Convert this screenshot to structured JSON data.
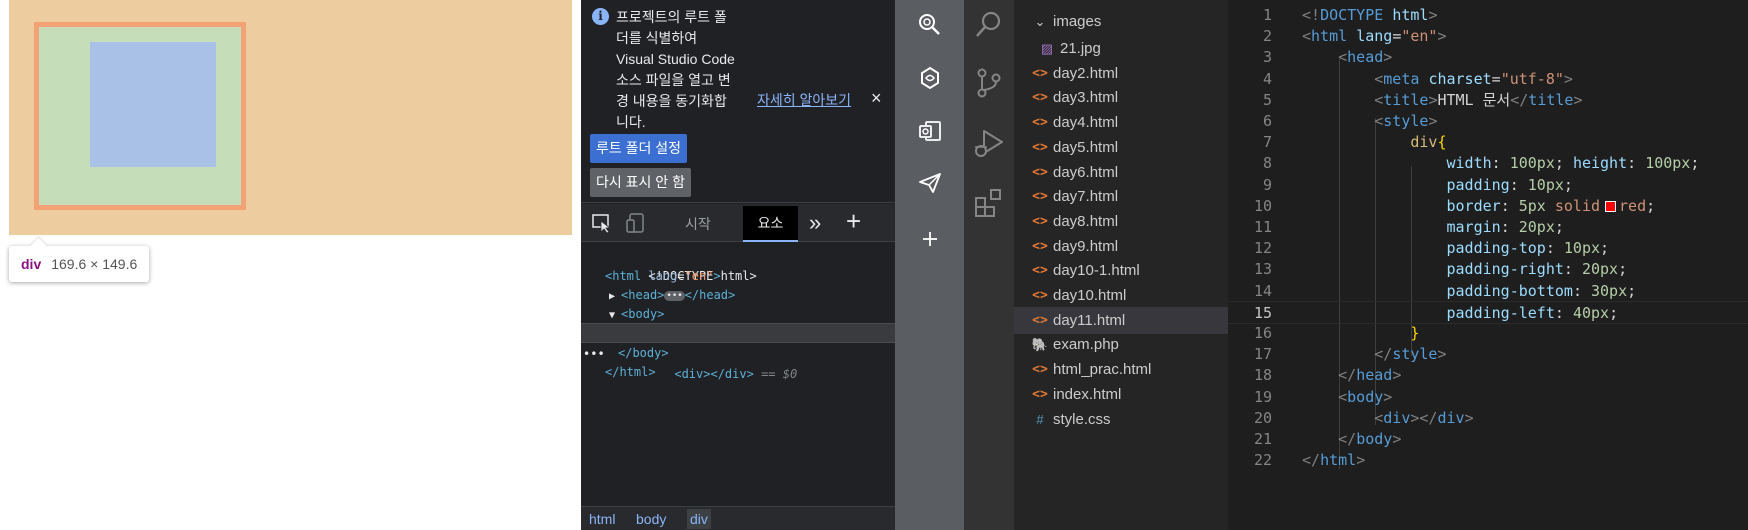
{
  "preview": {
    "tooltip": {
      "tag": "div",
      "dims": "169.6 × 149.6"
    }
  },
  "devtools": {
    "banner": {
      "message": "프로젝트의 루트 폴\n더를 식별하여\nVisual Studio Code\n소스 파일을 열고 변\n경 내용을 동기화합\n니다.",
      "learn_more": "자세히 알아보기",
      "close": "×",
      "set_root_button": "루트 폴더 설정",
      "dont_show_button": "다시 표시 안 함"
    },
    "tabs": {
      "start": "시작",
      "elements": "요소",
      "more": "»",
      "add": "+"
    },
    "dom": {
      "doctype": "<!DOCTYPE html>",
      "html_open_tag": "<html",
      "html_attr": "lang",
      "html_attr_value": "\"en\"",
      "html_close_bracket": ">",
      "head_open": "<head>",
      "head_ellipsis": "•••",
      "head_close": "</head>",
      "body_open": "<body>",
      "selected_div": "<div></div>",
      "selected_marker": "== $0",
      "row_dots": "•••",
      "body_close": "</body>",
      "html_close": "</html>"
    },
    "breadcrumb": [
      "html",
      "body",
      "div"
    ]
  },
  "vscode": {
    "explorer": {
      "folder": "images",
      "files": [
        "21.jpg",
        "day2.html",
        "day3.html",
        "day4.html",
        "day5.html",
        "day6.html",
        "day7.html",
        "day8.html",
        "day9.html",
        "day10-1.html",
        "day10.html",
        "day11.html",
        "exam.php",
        "html_prac.html",
        "index.html",
        "style.css"
      ],
      "active_file": "day11.html"
    },
    "editor": {
      "current_line": 15,
      "line_numbers": [
        "1",
        "2",
        "3",
        "4",
        "5",
        "6",
        "7",
        "8",
        "9",
        "10",
        "11",
        "12",
        "13",
        "14",
        "15",
        "16",
        "17",
        "18",
        "19",
        "20",
        "21",
        "22"
      ],
      "lines": [
        [
          [
            "c-bracket",
            "<!"
          ],
          [
            "c-tag",
            "DOCTYPE"
          ],
          [
            "c-txt",
            " "
          ],
          [
            "c-attr",
            "html"
          ],
          [
            "c-bracket",
            ">"
          ]
        ],
        [
          [
            "c-bracket",
            "<"
          ],
          [
            "c-tag",
            "html"
          ],
          [
            "c-txt",
            " "
          ],
          [
            "c-attr",
            "lang"
          ],
          [
            "c-txt",
            "="
          ],
          [
            "c-str",
            "\"en\""
          ],
          [
            "c-bracket",
            ">"
          ]
        ],
        [
          [
            "c-txt",
            "    "
          ],
          [
            "c-bracket",
            "<"
          ],
          [
            "c-tag",
            "head"
          ],
          [
            "c-bracket",
            ">"
          ]
        ],
        [
          [
            "c-txt",
            "        "
          ],
          [
            "c-bracket",
            "<"
          ],
          [
            "c-tag",
            "meta"
          ],
          [
            "c-txt",
            " "
          ],
          [
            "c-attr",
            "charset"
          ],
          [
            "c-txt",
            "="
          ],
          [
            "c-str",
            "\"utf-8\""
          ],
          [
            "c-bracket",
            ">"
          ]
        ],
        [
          [
            "c-txt",
            "        "
          ],
          [
            "c-bracket",
            "<"
          ],
          [
            "c-tag",
            "title"
          ],
          [
            "c-bracket",
            ">"
          ],
          [
            "c-txt",
            "HTML 문서"
          ],
          [
            "c-bracket",
            "</"
          ],
          [
            "c-tag",
            "title"
          ],
          [
            "c-bracket",
            ">"
          ]
        ],
        [
          [
            "c-txt",
            "        "
          ],
          [
            "c-bracket",
            "<"
          ],
          [
            "c-tag",
            "style"
          ],
          [
            "c-bracket",
            ">"
          ]
        ],
        [
          [
            "c-txt",
            "            "
          ],
          [
            "c-sel",
            "div"
          ],
          [
            "c-brace",
            "{"
          ]
        ],
        [
          [
            "c-txt",
            "                "
          ],
          [
            "c-prop",
            "width"
          ],
          [
            "c-txt",
            ": "
          ],
          [
            "c-num",
            "100px"
          ],
          [
            "c-txt",
            "; "
          ],
          [
            "c-prop",
            "height"
          ],
          [
            "c-txt",
            ": "
          ],
          [
            "c-num",
            "100px"
          ],
          [
            "c-txt",
            ";"
          ]
        ],
        [
          [
            "c-txt",
            "                "
          ],
          [
            "c-prop",
            "padding"
          ],
          [
            "c-txt",
            ": "
          ],
          [
            "c-num",
            "10px"
          ],
          [
            "c-txt",
            ";"
          ]
        ],
        [
          [
            "c-txt",
            "                "
          ],
          [
            "c-prop",
            "border"
          ],
          [
            "c-txt",
            ": "
          ],
          [
            "c-num",
            "5px"
          ],
          [
            "c-txt",
            " "
          ],
          [
            "c-val",
            "solid"
          ],
          [
            "swatch",
            ""
          ],
          [
            "c-val",
            "red"
          ],
          [
            "c-txt",
            ";"
          ]
        ],
        [
          [
            "c-txt",
            "                "
          ],
          [
            "c-prop",
            "margin"
          ],
          [
            "c-txt",
            ": "
          ],
          [
            "c-num",
            "20px"
          ],
          [
            "c-txt",
            ";"
          ]
        ],
        [
          [
            "c-txt",
            "                "
          ],
          [
            "c-prop",
            "padding-top"
          ],
          [
            "c-txt",
            ": "
          ],
          [
            "c-num",
            "10px"
          ],
          [
            "c-txt",
            ";"
          ]
        ],
        [
          [
            "c-txt",
            "                "
          ],
          [
            "c-prop",
            "padding-right"
          ],
          [
            "c-txt",
            ": "
          ],
          [
            "c-num",
            "20px"
          ],
          [
            "c-txt",
            ";"
          ]
        ],
        [
          [
            "c-txt",
            "                "
          ],
          [
            "c-prop",
            "padding-bottom"
          ],
          [
            "c-txt",
            ": "
          ],
          [
            "c-num",
            "30px"
          ],
          [
            "c-txt",
            ";"
          ]
        ],
        [
          [
            "c-txt",
            "                "
          ],
          [
            "c-prop",
            "padding-left"
          ],
          [
            "c-txt",
            ": "
          ],
          [
            "c-num",
            "40px"
          ],
          [
            "c-txt",
            ";"
          ]
        ],
        [
          [
            "c-txt",
            "            "
          ],
          [
            "c-brace",
            "}"
          ]
        ],
        [
          [
            "c-txt",
            "        "
          ],
          [
            "c-bracket",
            "</"
          ],
          [
            "c-tag",
            "style"
          ],
          [
            "c-bracket",
            ">"
          ]
        ],
        [
          [
            "c-txt",
            "    "
          ],
          [
            "c-bracket",
            "</"
          ],
          [
            "c-tag",
            "head"
          ],
          [
            "c-bracket",
            ">"
          ]
        ],
        [
          [
            "c-txt",
            "    "
          ],
          [
            "c-bracket",
            "<"
          ],
          [
            "c-tag",
            "body"
          ],
          [
            "c-bracket",
            ">"
          ]
        ],
        [
          [
            "c-txt",
            "        "
          ],
          [
            "c-bracket",
            "<"
          ],
          [
            "c-tag",
            "div"
          ],
          [
            "c-bracket",
            "></"
          ],
          [
            "c-tag",
            "div"
          ],
          [
            "c-bracket",
            ">"
          ]
        ],
        [
          [
            "c-txt",
            "    "
          ],
          [
            "c-bracket",
            "</"
          ],
          [
            "c-tag",
            "body"
          ],
          [
            "c-bracket",
            ">"
          ]
        ],
        [
          [
            "c-bracket",
            "</"
          ],
          [
            "c-tag",
            "html"
          ],
          [
            "c-bracket",
            ">"
          ]
        ]
      ]
    }
  }
}
